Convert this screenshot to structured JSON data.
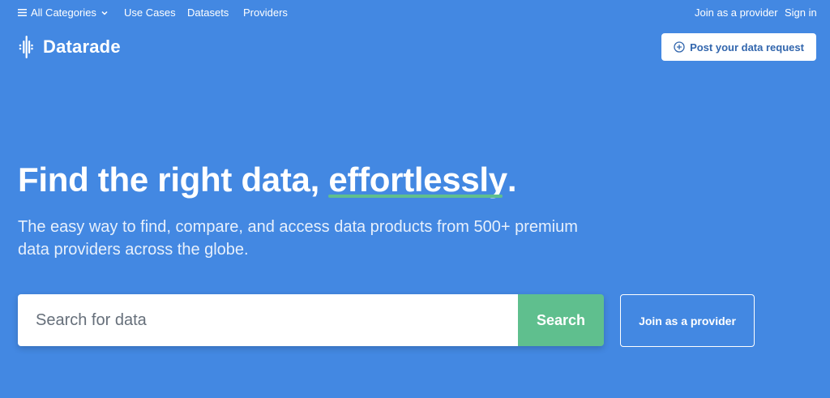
{
  "topnav": {
    "all_categories": "All Categories",
    "use_cases": "Use Cases",
    "datasets": "Datasets",
    "providers": "Providers",
    "join_provider": "Join as a provider",
    "sign_in": "Sign in"
  },
  "brand": {
    "name": "Datarade"
  },
  "header": {
    "post_request_label": "Post your data request"
  },
  "hero": {
    "title_prefix": "Find the right data, ",
    "title_highlight": "effortlessly",
    "title_suffix": ".",
    "subtitle": "The easy way to find, compare, and access data products from 500+ premium data providers across the globe."
  },
  "search": {
    "placeholder": "Search for data",
    "value": "",
    "button_label": "Search"
  },
  "cta": {
    "join_provider_label": "Join as a provider"
  },
  "colors": {
    "background": "#4388e2",
    "accent_green": "#5fbf8e",
    "button_text_blue": "#3266ad"
  },
  "icons": {
    "menu": "hamburger-icon",
    "dropdown": "chevron-down-icon",
    "logo": "datarade-logo-icon",
    "post": "plus-circle-icon"
  }
}
